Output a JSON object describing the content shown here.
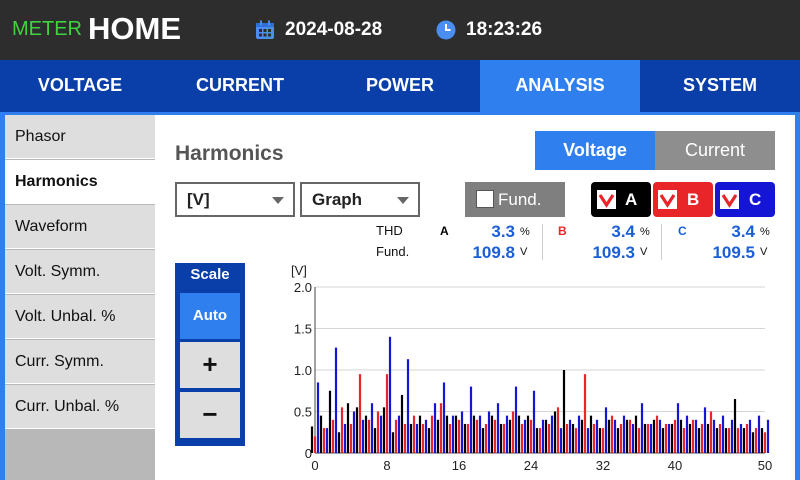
{
  "header": {
    "meter_label": "METER",
    "home_label": "HOME",
    "date": "2024-08-28",
    "time": "18:23:26",
    "date_icon": "calendar-icon",
    "time_icon": "clock-icon"
  },
  "nav": {
    "tabs": [
      {
        "label": "VOLTAGE",
        "active": false
      },
      {
        "label": "CURRENT",
        "active": false
      },
      {
        "label": "POWER",
        "active": false
      },
      {
        "label": "ANALYSIS",
        "active": true
      },
      {
        "label": "SYSTEM",
        "active": false
      }
    ]
  },
  "sidebar": {
    "items": [
      {
        "label": "Phasor",
        "active": false
      },
      {
        "label": "Harmonics",
        "active": true
      },
      {
        "label": "Waveform",
        "active": false
      },
      {
        "label": "Volt. Symm.",
        "active": false
      },
      {
        "label": "Volt. Unbal. %",
        "active": false
      },
      {
        "label": "Curr. Symm.",
        "active": false
      },
      {
        "label": "Curr. Unbal. %",
        "active": false
      }
    ]
  },
  "main": {
    "title": "Harmonics",
    "toggle": {
      "voltage": "Voltage",
      "current": "Current",
      "selected": "Voltage"
    },
    "unit_select": "[V]",
    "view_select": "Graph",
    "fund_label": "Fund.",
    "fund_checked": false,
    "phases": [
      {
        "label": "A",
        "color": "#000000",
        "checked": true
      },
      {
        "label": "B",
        "color": "#e8262a",
        "checked": true
      },
      {
        "label": "C",
        "color": "#1515d6",
        "checked": true
      }
    ],
    "meas_labels": {
      "thd": "THD",
      "fund": "Fund."
    },
    "readings": {
      "A": {
        "label": "A",
        "thd": "3.3",
        "thd_unit": "%",
        "fund": "109.8",
        "fund_unit": "V"
      },
      "B": {
        "label": "B",
        "thd": "3.4",
        "thd_unit": "%",
        "fund": "109.3",
        "fund_unit": "V"
      },
      "C": {
        "label": "C",
        "thd": "3.4",
        "thd_unit": "%",
        "fund": "109.5",
        "fund_unit": "V"
      }
    },
    "scale": {
      "label": "Scale",
      "auto": "Auto",
      "plus": "+",
      "minus": "−"
    }
  },
  "colors": {
    "accent": "#2f80ee",
    "nav_bg": "#0a3ea8",
    "phase_a": "#000000",
    "phase_b": "#e8262a",
    "phase_c": "#1515d6"
  },
  "chart_data": {
    "type": "bar",
    "ylabel": "[V]",
    "ylim": [
      0,
      2.0
    ],
    "yticks": [
      0,
      0.5,
      1.0,
      1.5,
      2.0
    ],
    "ytick_labels": [
      "0",
      "0.5",
      "1.0",
      "1.5",
      "2.0"
    ],
    "xlim": [
      0,
      50
    ],
    "xticks": [
      0,
      8,
      16,
      24,
      32,
      40,
      50
    ],
    "grid": true,
    "series": [
      {
        "name": "A",
        "color": "#000000",
        "values": [
          0.32,
          0.45,
          0.75,
          0.25,
          0.6,
          0.55,
          0.45,
          0.3,
          0.55,
          0.25,
          0.7,
          0.35,
          0.45,
          0.3,
          0.4,
          0.45,
          0.45,
          0.35,
          0.45,
          0.3,
          0.45,
          0.35,
          0.4,
          0.45,
          0.45,
          0.3,
          0.4,
          0.5,
          1.0,
          0.35,
          0.4,
          0.45,
          0.3,
          0.4,
          0.3,
          0.4,
          0.45,
          0.35,
          0.4,
          0.3,
          0.35,
          0.4,
          0.35,
          0.3,
          0.35,
          0.3,
          0.3,
          0.65,
          0.3,
          0.25,
          0.3
        ]
      },
      {
        "name": "B",
        "color": "#e8262a",
        "values": [
          0.2,
          0.3,
          0.4,
          0.55,
          0.35,
          0.95,
          0.4,
          0.5,
          0.95,
          0.4,
          0.35,
          0.45,
          0.35,
          0.45,
          0.6,
          0.35,
          0.4,
          0.35,
          0.4,
          0.35,
          0.4,
          0.35,
          0.5,
          0.35,
          0.4,
          0.3,
          0.35,
          0.55,
          0.35,
          0.3,
          0.95,
          0.35,
          0.3,
          0.45,
          0.35,
          0.4,
          0.3,
          0.35,
          0.45,
          0.35,
          0.4,
          0.3,
          0.4,
          0.35,
          0.5,
          0.35,
          0.3,
          0.3,
          0.35,
          0.3,
          0.25
        ]
      },
      {
        "name": "C",
        "color": "#1515d6",
        "values": [
          0.85,
          0.3,
          1.27,
          0.35,
          0.5,
          0.4,
          0.6,
          0.45,
          1.4,
          0.45,
          1.13,
          0.35,
          0.4,
          0.6,
          0.85,
          0.45,
          0.5,
          0.8,
          0.45,
          0.5,
          0.6,
          0.45,
          0.8,
          0.4,
          0.75,
          0.4,
          0.45,
          0.3,
          0.4,
          0.45,
          0.3,
          0.4,
          0.55,
          0.4,
          0.45,
          0.35,
          0.6,
          0.35,
          0.4,
          0.35,
          0.6,
          0.45,
          0.4,
          0.55,
          0.4,
          0.45,
          0.4,
          0.35,
          0.4,
          0.45,
          0.4
        ]
      }
    ]
  }
}
